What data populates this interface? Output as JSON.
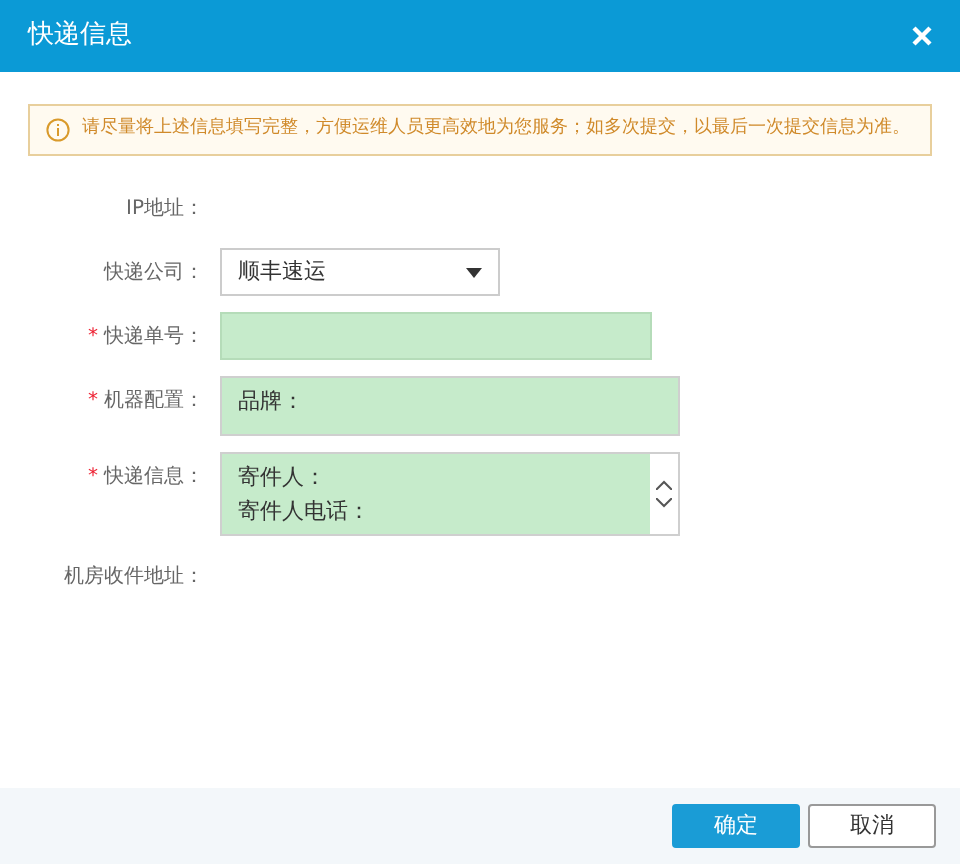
{
  "window": {
    "title": "快递信息"
  },
  "notice": "请尽量将上述信息填写完整，方便运维人员更高效地为您服务；如多次提交，以最后一次提交信息为准。",
  "fields": [
    {
      "kind": "static",
      "label": "IP地址："
    },
    {
      "kind": "select",
      "label": "快递公司：",
      "value": "顺丰速运"
    },
    {
      "kind": "input",
      "label": "快递单号：",
      "required_mark": "*"
    },
    {
      "kind": "textarea",
      "label": "机器配置：",
      "required_mark": "*",
      "lines": [
        "品牌："
      ],
      "scroll": false
    },
    {
      "kind": "textarea",
      "label": "快递信息：",
      "required_mark": "*",
      "lines": [
        "寄件人：",
        "寄件人电话："
      ],
      "scroll": true
    },
    {
      "kind": "static",
      "label": "机房收件地址："
    }
  ],
  "buttons": [
    {
      "label": "确定",
      "primary": true
    },
    {
      "label": "取消",
      "primary": false
    }
  ]
}
